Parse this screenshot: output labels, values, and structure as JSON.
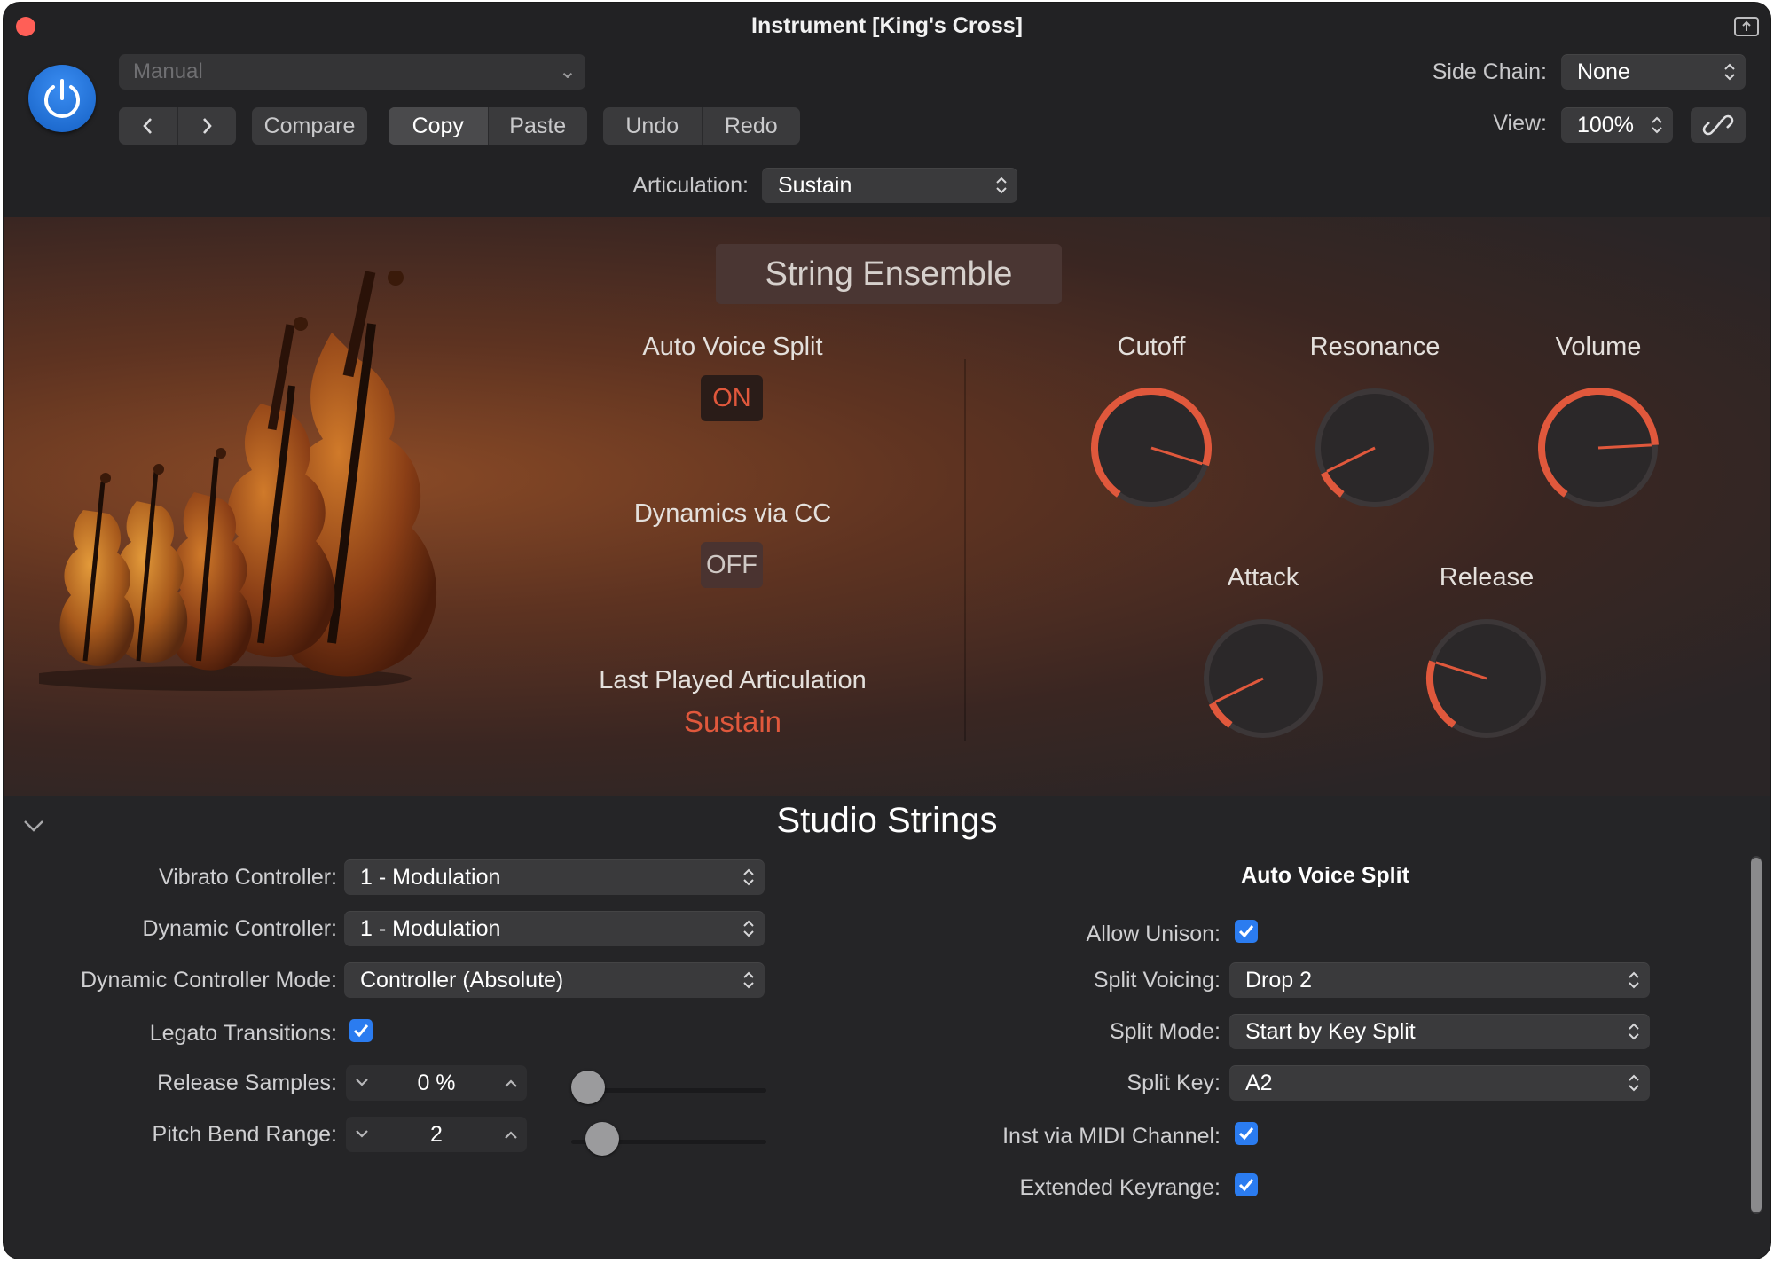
{
  "window": {
    "title": "Instrument [King's Cross]"
  },
  "header": {
    "preset": "Manual",
    "compare": "Compare",
    "copy": "Copy",
    "paste": "Paste",
    "undo": "Undo",
    "redo": "Redo",
    "side_chain_label": "Side Chain:",
    "side_chain_value": "None",
    "view_label": "View:",
    "view_value": "100%",
    "articulation_label": "Articulation:",
    "articulation_value": "Sustain"
  },
  "panel": {
    "title": "String Ensemble",
    "auto_voice_split": {
      "label": "Auto Voice Split",
      "state": "ON"
    },
    "dynamics_via_cc": {
      "label": "Dynamics via CC",
      "state": "OFF"
    },
    "last_played": {
      "label": "Last Played Articulation",
      "value": "Sustain"
    },
    "knobs": {
      "cutoff": {
        "label": "Cutoff",
        "value": 0.87
      },
      "resonance": {
        "label": "Resonance",
        "value": 0.1
      },
      "volume": {
        "label": "Volume",
        "value": 0.8
      },
      "attack": {
        "label": "Attack",
        "value": 0.1
      },
      "release": {
        "label": "Release",
        "value": 0.25
      }
    },
    "accent": "#e0583c"
  },
  "studio": {
    "title": "Studio Strings",
    "vibrato_label": "Vibrato Controller:",
    "vibrato_value": "1 - Modulation",
    "dynamic_label": "Dynamic Controller:",
    "dynamic_value": "1 - Modulation",
    "dynamic_mode_label": "Dynamic Controller Mode:",
    "dynamic_mode_value": "Controller (Absolute)",
    "legato_label": "Legato Transitions:",
    "release_label": "Release Samples:",
    "release_value": "0 %",
    "release_level": 0.0,
    "pitch_label": "Pitch Bend Range:",
    "pitch_value": "2",
    "pitch_level": 0.09,
    "avs_title": "Auto Voice Split",
    "allow_unison_label": "Allow Unison:",
    "split_voicing_label": "Split Voicing:",
    "split_voicing_value": "Drop 2",
    "split_mode_label": "Split Mode:",
    "split_mode_value": "Start by Key Split",
    "split_key_label": "Split Key:",
    "split_key_value": "A2",
    "inst_midi_label": "Inst via MIDI Channel:",
    "extended_label": "Extended Keyrange:"
  }
}
